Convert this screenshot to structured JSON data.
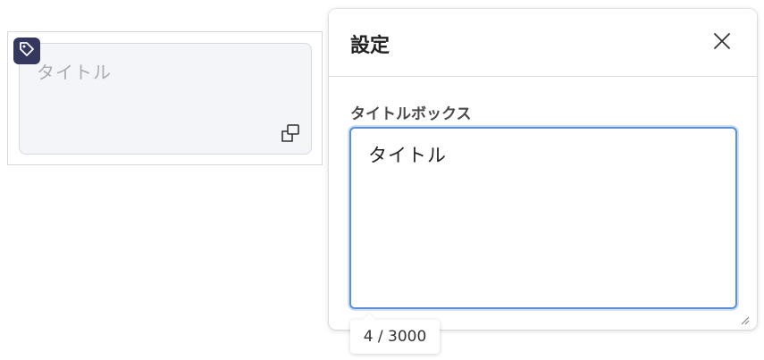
{
  "widget": {
    "placeholder": "タイトル",
    "tag_icon": "tag-icon",
    "expand_icon": "expand-icon"
  },
  "panel": {
    "title": "設定",
    "close_icon": "close-icon",
    "field_label": "タイトルボックス",
    "field_value": "タイトル",
    "counter": "4 / 3000"
  },
  "colors": {
    "badge": "#34385e",
    "focus_border": "#5b8fd6"
  }
}
